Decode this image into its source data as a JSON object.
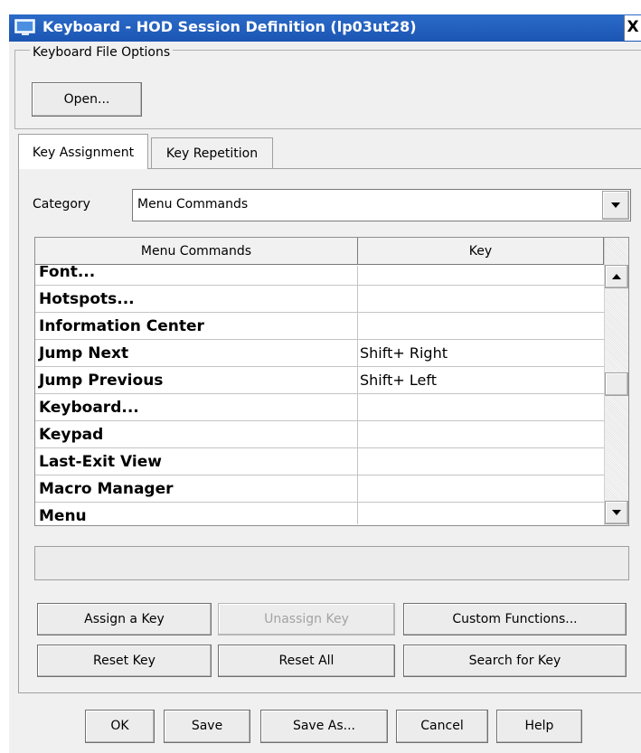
{
  "window": {
    "title": "Keyboard - HOD Session Definition (lp03ut28)",
    "close_glyph": "X"
  },
  "file_options": {
    "group_label": "Keyboard File Options",
    "open_label": "Open..."
  },
  "tabs": [
    {
      "label": "Key Assignment",
      "active": true
    },
    {
      "label": "Key Repetition",
      "active": false
    }
  ],
  "category": {
    "label": "Category",
    "value": "Menu Commands"
  },
  "table": {
    "columns": [
      "Menu Commands",
      "Key"
    ],
    "rows": [
      {
        "command": "Font...",
        "key": ""
      },
      {
        "command": "Hotspots...",
        "key": ""
      },
      {
        "command": "Information Center",
        "key": ""
      },
      {
        "command": "Jump Next",
        "key": "Shift+ Right"
      },
      {
        "command": "Jump Previous",
        "key": "Shift+ Left"
      },
      {
        "command": "Keyboard...",
        "key": ""
      },
      {
        "command": "Keypad",
        "key": ""
      },
      {
        "command": "Last-Exit View",
        "key": ""
      },
      {
        "command": "Macro Manager",
        "key": ""
      },
      {
        "command": "Menu",
        "key": ""
      }
    ]
  },
  "actions": {
    "assign": "Assign a Key",
    "unassign": "Unassign Key",
    "custom": "Custom Functions...",
    "reset_key": "Reset Key",
    "reset_all": "Reset All",
    "search": "Search for Key"
  },
  "footer": {
    "ok": "OK",
    "save": "Save",
    "save_as": "Save As...",
    "cancel": "Cancel",
    "help": "Help"
  },
  "icons": {
    "title_icon": "terminal-window-icon",
    "dropdown": "chevron-down-icon",
    "scroll_up": "arrow-up-icon",
    "scroll_down": "arrow-down-icon"
  },
  "colors": {
    "titlebar": "#1c55b3",
    "dialog_bg": "#f0f0f0",
    "disabled_text": "#a3a3a3"
  }
}
